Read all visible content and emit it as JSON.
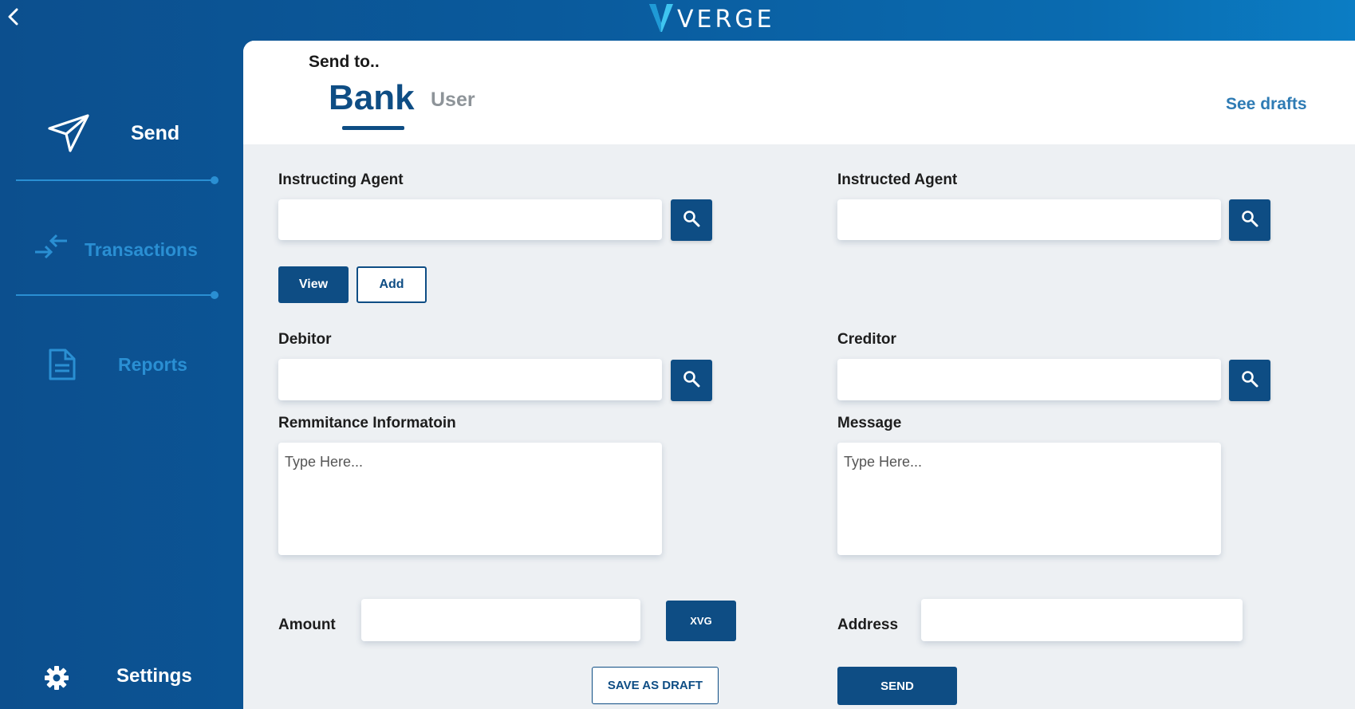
{
  "app": {
    "brand": "VERGE"
  },
  "colors": {
    "primary": "#0e4d84",
    "accent": "#2a8fd3",
    "muted_text": "#8e9499",
    "link": "#2e7bb4"
  },
  "sidebar": {
    "items": [
      {
        "label": "Send",
        "icon": "send-icon"
      },
      {
        "label": "Transactions",
        "icon": "transactions-arrows-icon"
      },
      {
        "label": "Reports",
        "icon": "document-icon"
      }
    ],
    "settings": {
      "label": "Settings",
      "icon": "gear-icon"
    }
  },
  "header": {
    "send_to": "Send to..",
    "tabs": [
      {
        "label": "Bank",
        "active": true
      },
      {
        "label": "User",
        "active": false
      }
    ],
    "see_drafts": "See drafts"
  },
  "form": {
    "instructing_agent": {
      "label": "Instructing Agent",
      "value": ""
    },
    "instructed_agent": {
      "label": "Instructed Agent",
      "value": ""
    },
    "view_label": "View",
    "add_label": "Add",
    "debitor": {
      "label": "Debitor",
      "value": ""
    },
    "creditor": {
      "label": "Creditor",
      "value": ""
    },
    "remittance": {
      "label": "Remmitance Informatoin",
      "placeholder": "Type Here..."
    },
    "message": {
      "label": "Message",
      "placeholder": "Type Here..."
    },
    "amount": {
      "label": "Amount",
      "value": ""
    },
    "currency_label": "XVG",
    "address": {
      "label": "Address",
      "value": ""
    },
    "save_draft_label": "SAVE AS DRAFT",
    "send_label": "SEND"
  }
}
